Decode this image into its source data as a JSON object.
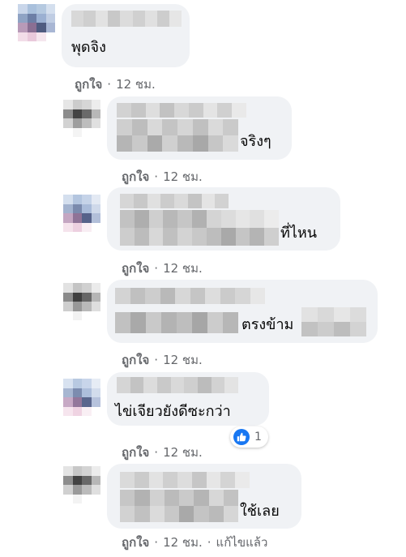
{
  "comments": [
    {
      "text": "พุดจิง",
      "meta_like": "ถูกใจ",
      "meta_time": "12 ชม."
    },
    {
      "text": "จริงๆ",
      "meta_like": "ถูกใจ",
      "meta_time": "12 ชม."
    },
    {
      "text": "ที่ไหน",
      "meta_like": "ถูกใจ",
      "meta_time": "12 ชม."
    },
    {
      "text": "ตรงข้าม",
      "meta_like": "ถูกใจ",
      "meta_time": "12 ชม."
    },
    {
      "text": "ไข่เจียวยังดีซะกว่า",
      "meta_like": "ถูกใจ",
      "meta_time": "12 ชม.",
      "reaction": {
        "icon": "like-icon",
        "count": "1",
        "color": "#1877f2"
      }
    },
    {
      "text": "ใช้เลย",
      "meta_like": "ถูกใจ",
      "meta_time": "12 ชม.",
      "edited": "แก้ไขแล้ว"
    }
  ],
  "separator": "·",
  "colors": {
    "bubble": "#f0f2f5",
    "meta": "#65676b",
    "text": "#050505",
    "like_blue": "#1877f2"
  }
}
